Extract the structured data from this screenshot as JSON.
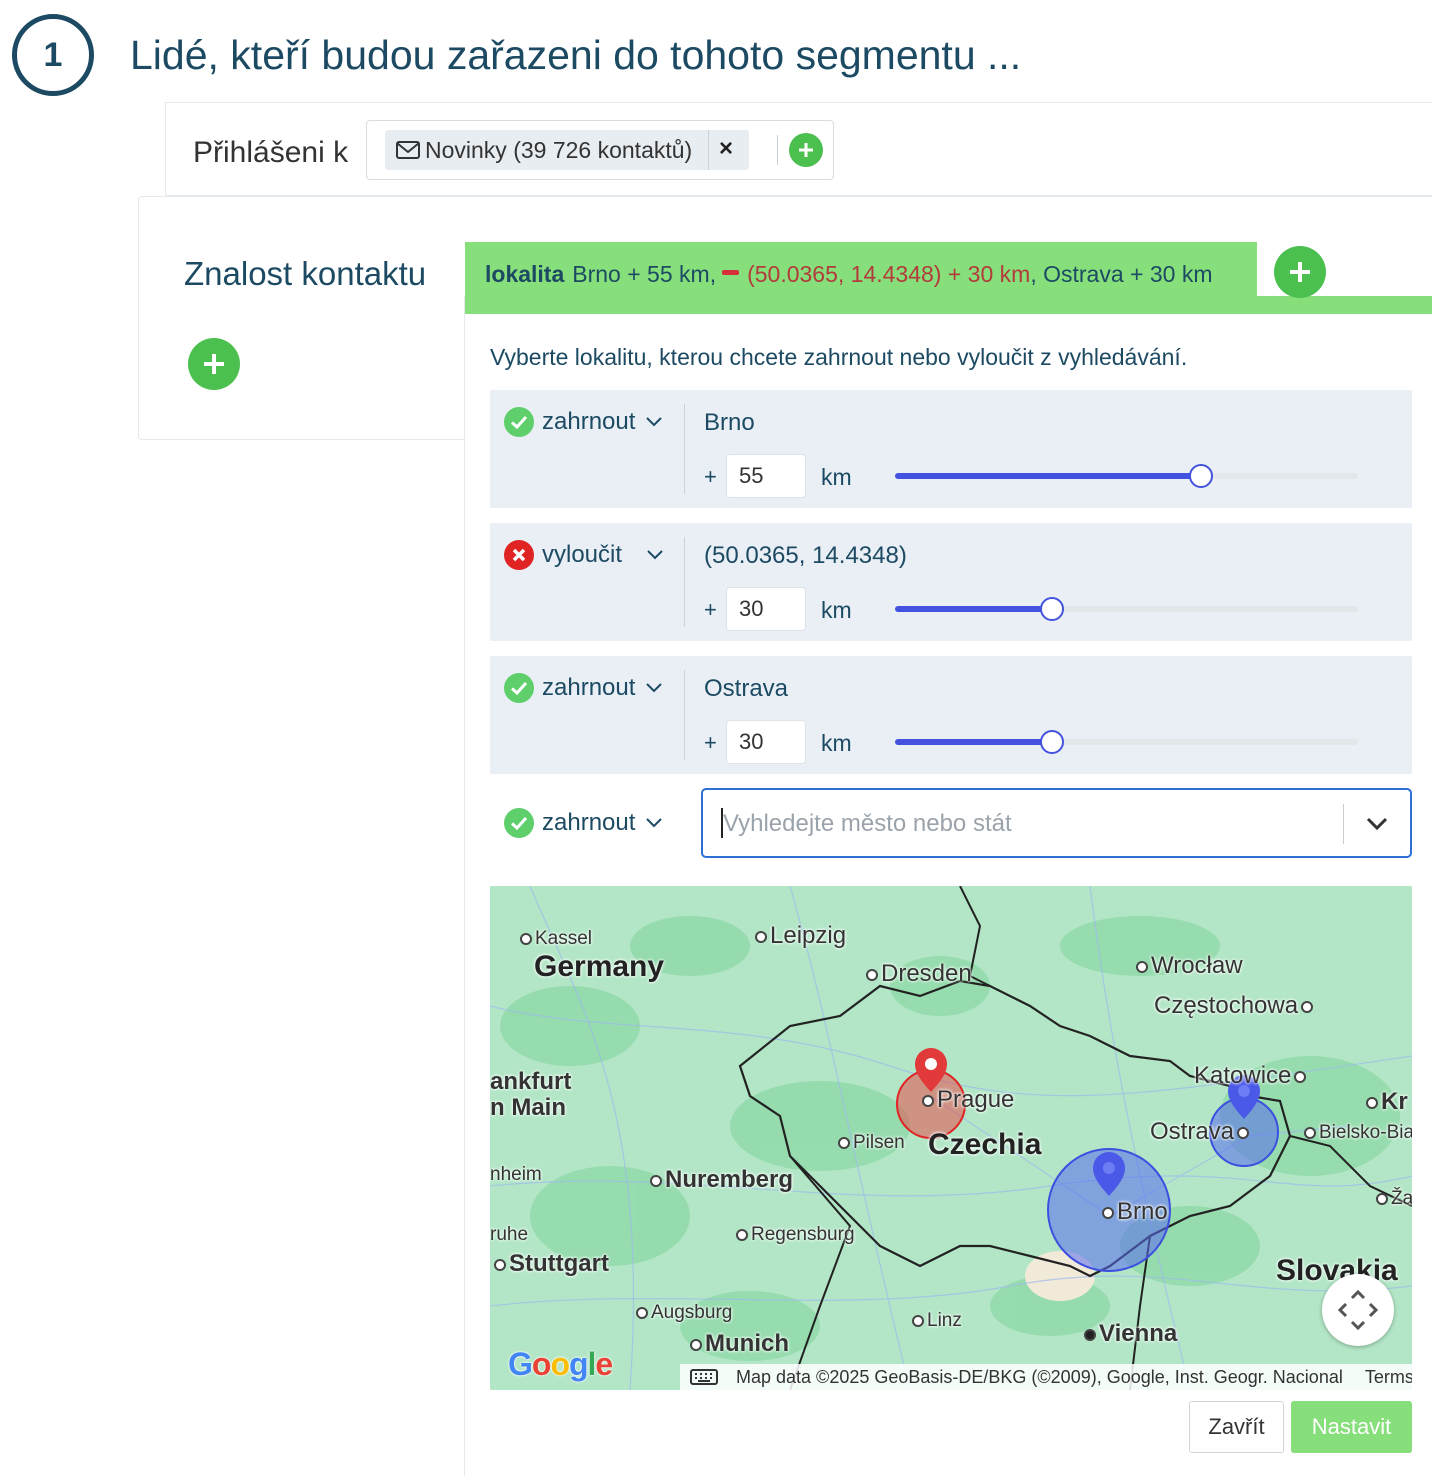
{
  "step": {
    "number": "1",
    "title": "Lidé, kteří budou zařazeni do tohoto segmentu ..."
  },
  "subscription": {
    "label": "Přihlášeni k",
    "tag_label": "Novinky (39 726 kontaktů)",
    "remove_glyph": "×"
  },
  "knowledge": {
    "label": "Znalost kontaktu"
  },
  "filter_tab": {
    "keyword": "lokalita",
    "part1": "Brno + 55 km,",
    "part2_excluded": "(50.0365, 14.4348) + 30 km",
    "part3": ", Ostrava + 30 km"
  },
  "popover": {
    "instruction": "Vyberte lokalitu, kterou chcete zahrnout nebo vyloučit z vyhledávání.",
    "locations": [
      {
        "mode": "zahrnout",
        "status": "include",
        "place": "Brno",
        "plus": "+",
        "km": "55",
        "unit": "km",
        "fraction": 0.66
      },
      {
        "mode": "vyloučit",
        "status": "exclude",
        "place": "(50.0365, 14.4348)",
        "plus": "+",
        "km": "30",
        "unit": "km",
        "fraction": 0.34
      },
      {
        "mode": "zahrnout",
        "status": "include",
        "place": "Ostrava",
        "plus": "+",
        "km": "30",
        "unit": "km",
        "fraction": 0.34
      }
    ],
    "new_location": {
      "mode": "zahrnout",
      "placeholder": "Vyhledejte město nebo stát"
    },
    "buttons": {
      "close": "Zavřít",
      "submit": "Nastavit"
    }
  },
  "map": {
    "labels": {
      "kassel": "Kassel",
      "leipzig": "Leipzig",
      "germany": "Germany",
      "dresden": "Dresden",
      "wroclaw": "Wrocław",
      "czestochowa": "Częstochowa",
      "frankfurt1": "ankfurt",
      "frankfurt2": "n Main",
      "katowice": "Katowice",
      "krakow": "Kr",
      "prague": "Prague",
      "ostrava": "Ostrava",
      "bielsko": "Bielsko-Bia",
      "pilsen": "Pilsen",
      "czechia": "Czechia",
      "mannheim": "nheim",
      "nuremberg": "Nuremberg",
      "zilina": "Ža",
      "brno": "Brno",
      "karlsruhe": "ruhe",
      "regensburg": "Regensburg",
      "stuttgart": "Stuttgart",
      "slovakia": "Slovakia",
      "augsburg": "Augsburg",
      "linz": "Linz",
      "munich": "Munich",
      "vienna": "Vienna"
    },
    "attribution": "Map data ©2025 GeoBasis-DE/BKG (©2009), Google, Inst. Geogr. Nacional",
    "terms": "Terms",
    "logo": "Google"
  },
  "colors": {
    "accent": "#86df7a",
    "add_button": "#4cc04f",
    "slider": "#4353e0",
    "exclude": "#e02424",
    "text": "#1c4a63"
  }
}
